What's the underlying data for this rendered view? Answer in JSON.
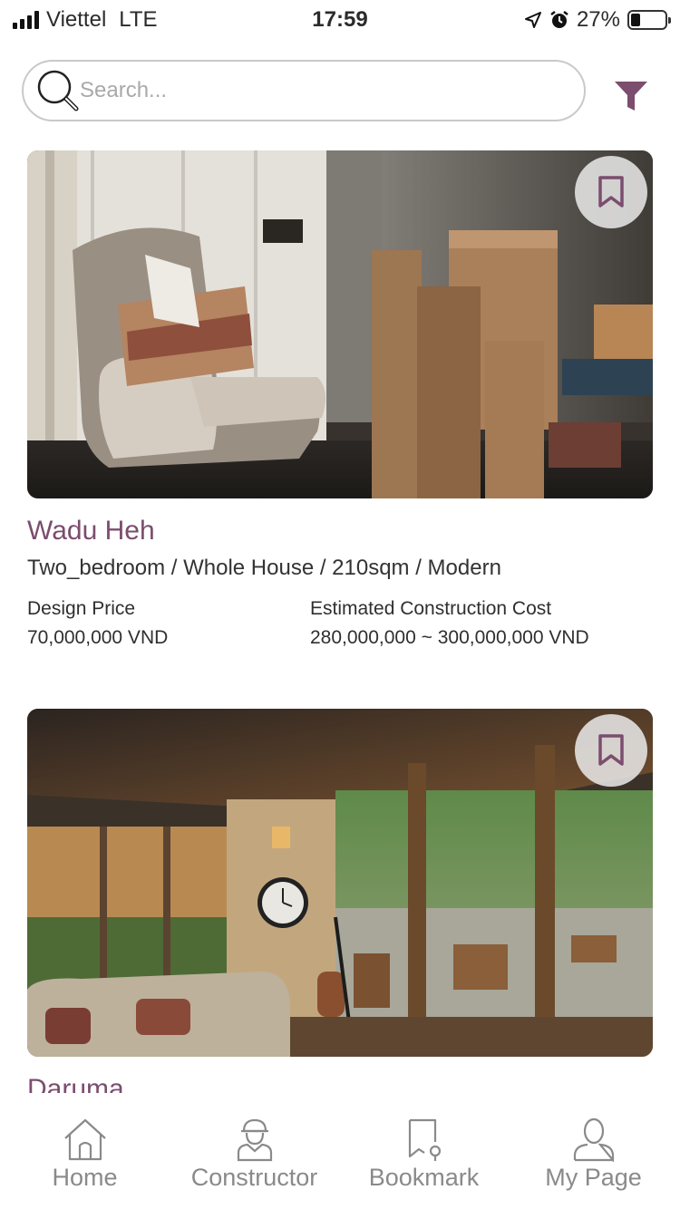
{
  "status_bar": {
    "carrier": "Viettel",
    "network": "LTE",
    "time": "17:59",
    "battery": "27%",
    "battery_level": 0.27
  },
  "search": {
    "placeholder": "Search..."
  },
  "icons": {
    "search": "search-icon",
    "filter": "filter-icon",
    "bookmark": "bookmark-icon",
    "home": "home-icon",
    "constructor": "constructor-icon",
    "bookmark_tab": "bookmark-tab-icon",
    "my_page": "user-icon"
  },
  "colors": {
    "accent": "#7b4d6e",
    "tab_inactive": "#8a8a8a"
  },
  "listings": [
    {
      "title": "Wadu Heh",
      "spec": "Two_bedroom / Whole House / 210sqm / Modern",
      "design_price_label": "Design Price",
      "design_price": "70,000,000 VND",
      "construction_cost_label": "Estimated Construction Cost",
      "construction_cost": "280,000,000 ~ 300,000,000 VND"
    },
    {
      "title": "Daruma"
    }
  ],
  "tabs": [
    {
      "label": "Home"
    },
    {
      "label": "Constructor"
    },
    {
      "label": "Bookmark"
    },
    {
      "label": "My Page"
    }
  ]
}
